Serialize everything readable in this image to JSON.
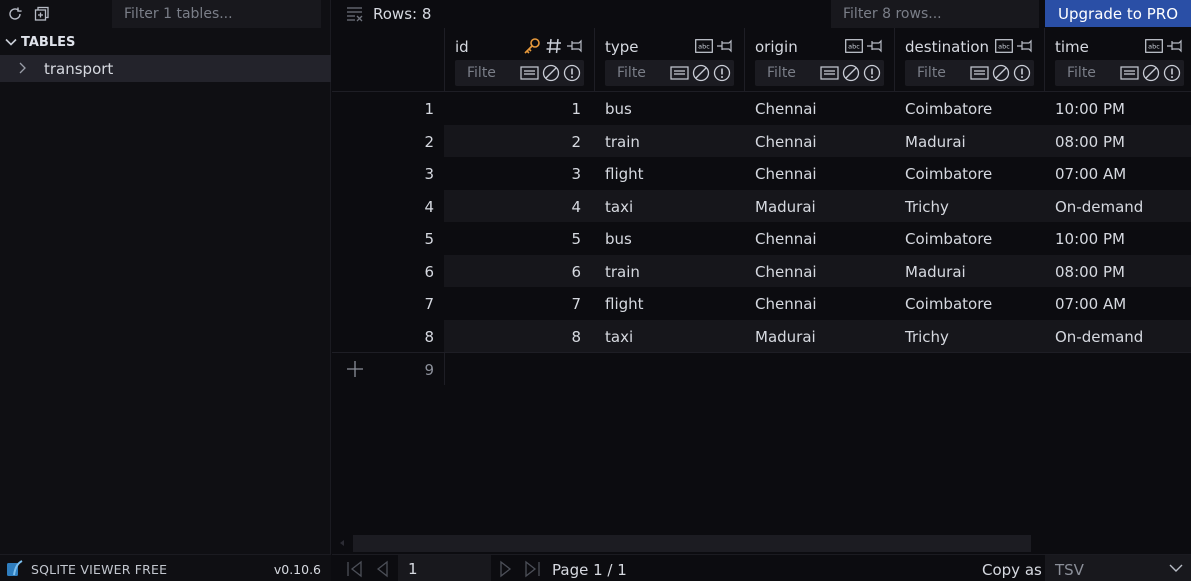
{
  "sidebar": {
    "filter_placeholder": "Filter 1 tables...",
    "section_title": "TABLES",
    "tables": [
      {
        "label": "transport"
      }
    ],
    "app_name": "SQLITE VIEWER FREE",
    "version": "v0.10.6"
  },
  "toolbar": {
    "rows_label": "Rows: 8",
    "filter_placeholder": "Filter 8 rows...",
    "upgrade_label": "Upgrade to PRO"
  },
  "columns": [
    {
      "name": "id",
      "type_icon": "hash-icon",
      "primary_key": true,
      "filter_placeholder": "Filte"
    },
    {
      "name": "type",
      "type_icon": "abc-icon",
      "primary_key": false,
      "filter_placeholder": "Filte"
    },
    {
      "name": "origin",
      "type_icon": "abc-icon",
      "primary_key": false,
      "filter_placeholder": "Filte"
    },
    {
      "name": "destination",
      "type_icon": "abc-icon",
      "primary_key": false,
      "filter_placeholder": "Filte"
    },
    {
      "name": "time",
      "type_icon": "abc-icon",
      "primary_key": false,
      "filter_placeholder": "Filte"
    }
  ],
  "rows": [
    {
      "num": "1",
      "id": "1",
      "type": "bus",
      "origin": "Chennai",
      "destination": "Coimbatore",
      "time": "10:00 PM"
    },
    {
      "num": "2",
      "id": "2",
      "type": "train",
      "origin": "Chennai",
      "destination": "Madurai",
      "time": "08:00 PM"
    },
    {
      "num": "3",
      "id": "3",
      "type": "flight",
      "origin": "Chennai",
      "destination": "Coimbatore",
      "time": "07:00 AM"
    },
    {
      "num": "4",
      "id": "4",
      "type": "taxi",
      "origin": "Madurai",
      "destination": "Trichy",
      "time": "On-demand"
    },
    {
      "num": "5",
      "id": "5",
      "type": "bus",
      "origin": "Chennai",
      "destination": "Coimbatore",
      "time": "10:00 PM"
    },
    {
      "num": "6",
      "id": "6",
      "type": "train",
      "origin": "Chennai",
      "destination": "Madurai",
      "time": "08:00 PM"
    },
    {
      "num": "7",
      "id": "7",
      "type": "flight",
      "origin": "Chennai",
      "destination": "Coimbatore",
      "time": "07:00 AM"
    },
    {
      "num": "8",
      "id": "8",
      "type": "taxi",
      "origin": "Madurai",
      "destination": "Trichy",
      "time": "On-demand"
    }
  ],
  "new_row_num": "9",
  "pagination": {
    "page_input_value": "1",
    "page_label": "Page 1 / 1"
  },
  "copy": {
    "label": "Copy as",
    "format": "TSV"
  },
  "colors": {
    "accent": "#2a4fa6",
    "key_icon": "#e89a3c",
    "background": "#0c0c10",
    "row_alt": "#16161b"
  }
}
